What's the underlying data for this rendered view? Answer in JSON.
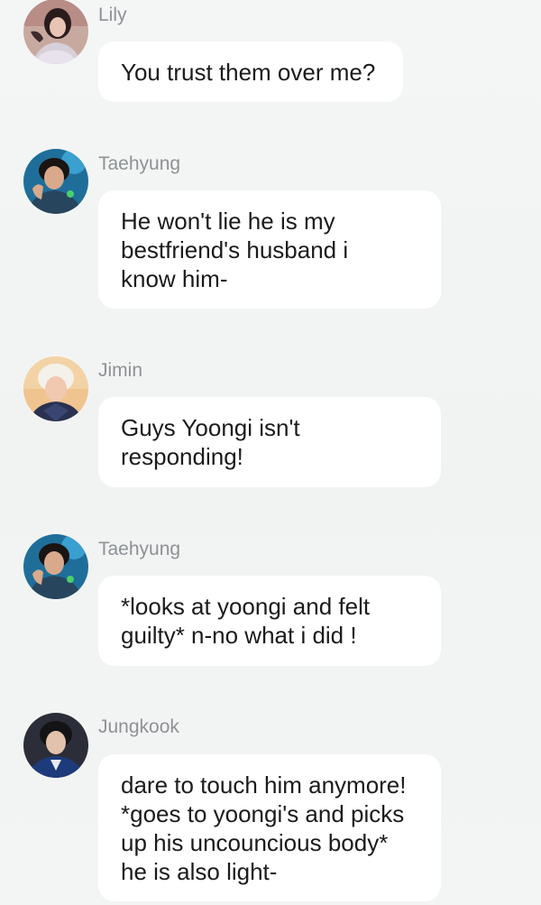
{
  "messages": [
    {
      "sender": "Lily",
      "text": "You trust them over me?",
      "avatar_icon": "profile-photo-icon"
    },
    {
      "sender": "Taehyung",
      "text": "He won't lie he is my\nbestfriend's husband i\nknow him-",
      "avatar_icon": "profile-photo-icon"
    },
    {
      "sender": "Jimin",
      "text": "Guys Yoongi isn't\nresponding!",
      "avatar_icon": "profile-photo-icon"
    },
    {
      "sender": "Taehyung",
      "text": "*looks at yoongi and felt\nguilty* n-no what i did !",
      "avatar_icon": "profile-photo-icon"
    },
    {
      "sender": "Jungkook",
      "text": "dare to touch him anymore!\n*goes to yoongi's and picks\nup his uncouncious body*\nhe is also light-",
      "avatar_icon": "profile-photo-icon"
    }
  ],
  "colors": {
    "background": "#f3f5f5",
    "bubble": "#ffffff",
    "sender_text": "#8e9295",
    "message_text": "#1b1b1b"
  }
}
